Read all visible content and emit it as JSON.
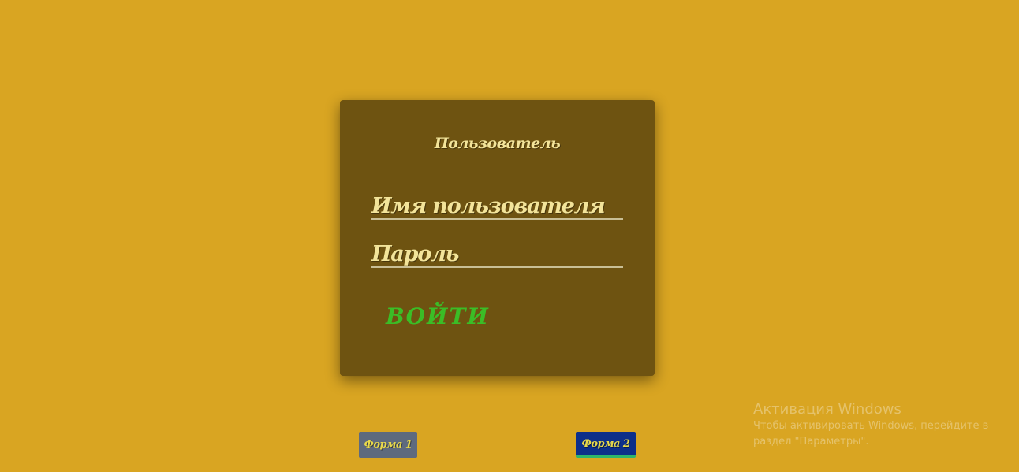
{
  "card": {
    "title": "Пользователь",
    "username_label": "Имя пользователя",
    "password_label": "Пароль",
    "login_button": "ВОЙТИ"
  },
  "tabs": [
    {
      "label": "Форма 1",
      "active": false
    },
    {
      "label": "Форма 2",
      "active": true
    }
  ],
  "watermark": {
    "title": "Активация Windows",
    "text": "Чтобы активировать Windows, перейдите в раздел \"Параметры\"."
  },
  "colors": {
    "background": "#d9a522",
    "card": "#6e5311",
    "label_text": "#f3e49a",
    "login_button": "#3bbd26",
    "tab_inactive": "#5e6a7e",
    "tab_active": "#0d2f8a",
    "tab_active_underline": "#2fb56a"
  }
}
